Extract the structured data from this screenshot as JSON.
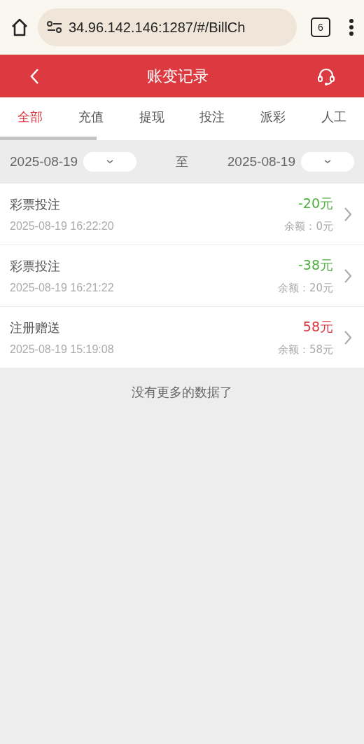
{
  "browser": {
    "url": "34.96.142.146:1287/#/BillCh",
    "tab_count": "6"
  },
  "header": {
    "title": "账变记录"
  },
  "tabs": [
    {
      "label": "全部",
      "selected": true
    },
    {
      "label": "充值",
      "selected": false
    },
    {
      "label": "提现",
      "selected": false
    },
    {
      "label": "投注",
      "selected": false
    },
    {
      "label": "派彩",
      "selected": false
    },
    {
      "label": "人工",
      "selected": false
    }
  ],
  "date_filter": {
    "start": "2025-08-19",
    "separator": "至",
    "end": "2025-08-19"
  },
  "records": [
    {
      "title": "彩票投注",
      "time": "2025-08-19 16:22:20",
      "amount": "-20元",
      "color": "#4caf3c",
      "balance": "余额：0元"
    },
    {
      "title": "彩票投注",
      "time": "2025-08-19 16:21:22",
      "amount": "-38元",
      "color": "#4caf3c",
      "balance": "余额：20元"
    },
    {
      "title": "注册赠送",
      "time": "2025-08-19 15:19:08",
      "amount": "58元",
      "color": "#d9363e",
      "balance": "余额：58元"
    }
  ],
  "footer_note": "没有更多的数据了"
}
